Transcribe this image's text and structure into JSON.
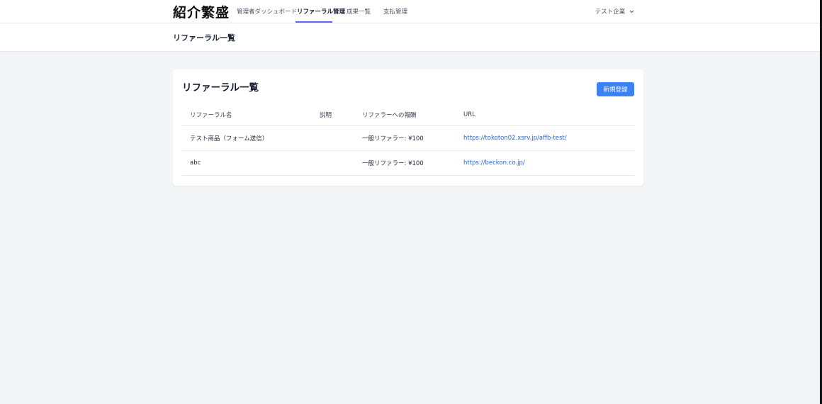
{
  "header": {
    "brand": "紹介繁盛",
    "nav": [
      {
        "label": "管理者ダッシュボード"
      },
      {
        "label": "リファーラル管理",
        "active": true
      },
      {
        "label": "成果一覧"
      },
      {
        "label": "支払管理"
      }
    ],
    "user_menu": {
      "label": "テスト企業",
      "icon": "chevron-down-icon"
    }
  },
  "subheader": {
    "title": "リファーラル一覧"
  },
  "card": {
    "title": "リファーラル一覧",
    "new_button_label": "新規登録",
    "table": {
      "headers": [
        "リファーラル名",
        "説明",
        "リファラーへの報酬",
        "URL"
      ],
      "rows": [
        {
          "name": "テスト商品（フォーム送信）",
          "description": "",
          "reward": "一般リファラー: ¥100",
          "url": "https://tokoton02.xsrv.jp/affb-test/"
        },
        {
          "name": "abc",
          "description": "",
          "reward": "一般リファラー: ¥100",
          "url": "https://beckon.co.jp/"
        }
      ]
    }
  },
  "colors": {
    "accent": "#3b82f6",
    "nav_underline": "#6366f1",
    "link": "#2563eb",
    "background": "#f3f4f6"
  }
}
